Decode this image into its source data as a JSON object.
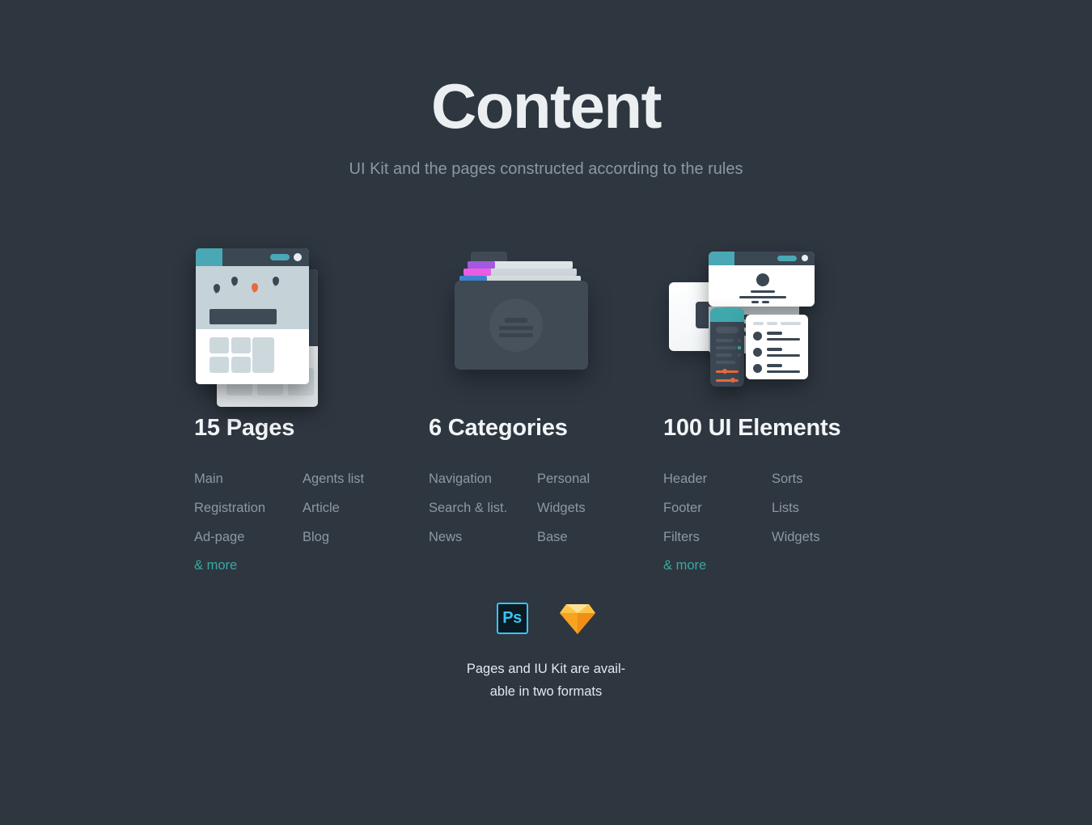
{
  "header": {
    "title": "Content",
    "subtitle": "UI Kit and the pages constructed according to the rules"
  },
  "columns": [
    {
      "id": "pages",
      "illustration": "browser-windows-illustration",
      "title": "15 Pages",
      "links_left": [
        "Main",
        "Registration",
        "Ad-page"
      ],
      "links_right": [
        "Agents list",
        "Article",
        "Blog"
      ],
      "more_label": "& more"
    },
    {
      "id": "categories",
      "illustration": "folder-illustration",
      "title": "6 Categories",
      "links_left": [
        "Navigation",
        "Search & list.",
        "News"
      ],
      "links_right": [
        "Personal",
        "Widgets",
        "Base"
      ],
      "more_label": ""
    },
    {
      "id": "ui-elements",
      "illustration": "ui-elements-illustration",
      "title": "100 UI Elements",
      "links_left": [
        "Header",
        "Footer",
        "Filters"
      ],
      "links_right": [
        "Sorts",
        "Lists",
        "Widgets"
      ],
      "more_label": "& more"
    }
  ],
  "footer": {
    "formats": [
      {
        "name": "photoshop-icon",
        "label": "Ps"
      },
      {
        "name": "sketch-icon",
        "label": ""
      }
    ],
    "note_line1": "Pages and IU Kit are avail-",
    "note_line2": "able in two formats"
  },
  "colors": {
    "background": "#2e3640",
    "accent_teal": "#3aa8a0",
    "title_text": "#eceff1",
    "muted_text": "#8c98a4",
    "illustration_dark": "#3b4753",
    "illustration_teal": "#4aa7b4",
    "illustration_orange": "#e8693f",
    "folder_tab_purple": "#a45ae0",
    "folder_tab_magenta": "#ec5fe8",
    "folder_tab_blue": "#3f88d8",
    "photoshop_cyan": "#36c5f5",
    "sketch_orange": "#f7a825"
  }
}
